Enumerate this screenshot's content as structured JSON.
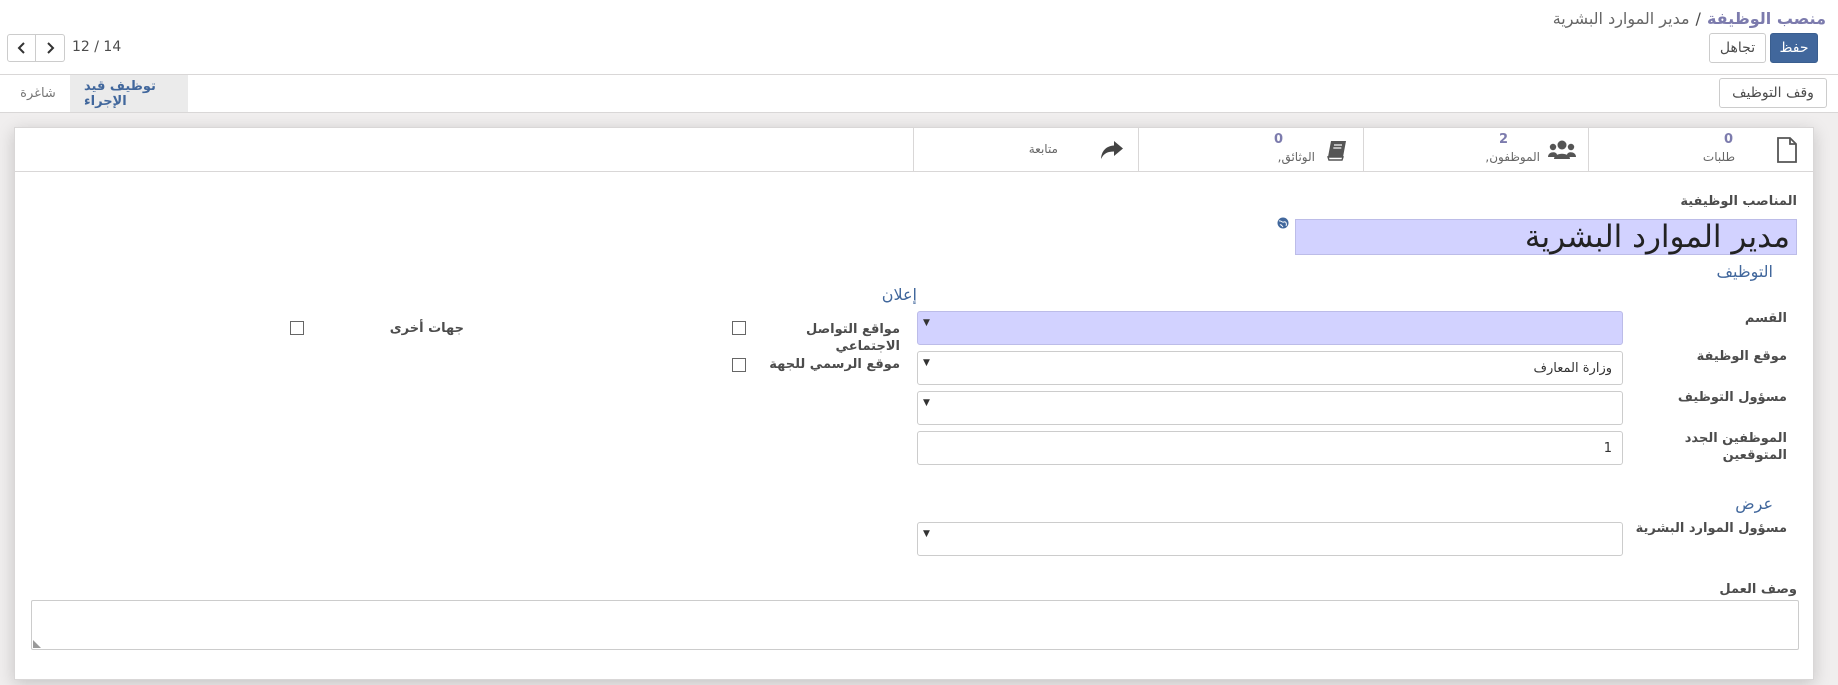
{
  "breadcrumb": {
    "parent": "منصب الوظيفة",
    "separator": "/",
    "current": "مدير الموارد البشرية"
  },
  "toolbar": {
    "save_label": "حفظ",
    "discard_label": "تجاهل"
  },
  "pager": {
    "value": "12 / 14"
  },
  "header": {
    "stop_recruitment_label": "وقف التوظيف",
    "stages": [
      {
        "label": "توظيف قيد الإجراء",
        "active": true
      },
      {
        "label": "شاغرة",
        "active": false
      }
    ]
  },
  "stat_buttons": {
    "applications": {
      "count": "0",
      "label": "طلبات",
      "icon": "file-icon"
    },
    "employees": {
      "count": "2",
      "label": "الموظفون,",
      "icon": "users-icon"
    },
    "documents": {
      "count": "0",
      "label": "الوثائق,",
      "icon": "book-icon"
    },
    "follow": {
      "label": "متابعة",
      "icon": "share-icon"
    }
  },
  "form": {
    "name_label": "المناصب الوظيفية",
    "name_value": "مدير الموارد البشرية",
    "recruitment_group": "التوظيف",
    "department_label": "القسم",
    "department_value": "",
    "location_label": "موقع الوظيفة",
    "location_value": "وزارة المعارف",
    "recruiter_label": "مسؤول التوظيف",
    "recruiter_value": "",
    "expected_label_line1": "الموظفين الجدد",
    "expected_label_line2": "المتوقعين",
    "expected_value": "1",
    "offer_group": "عرض",
    "hr_responsible_label": "مسؤول الموارد البشرية",
    "hr_responsible_value": "",
    "publish_group": "إعلان",
    "social_label_line1": "مواقع التواصل",
    "social_label_line2": "الاجتماعي",
    "official_site_label": "موقع الرسمي للجهة",
    "other_label": "جهات أخرى",
    "description_label": "وصف العمل"
  },
  "colors": {
    "primary": "#41679c",
    "accent": "#7c7bad",
    "required": "#d2d2ff"
  }
}
